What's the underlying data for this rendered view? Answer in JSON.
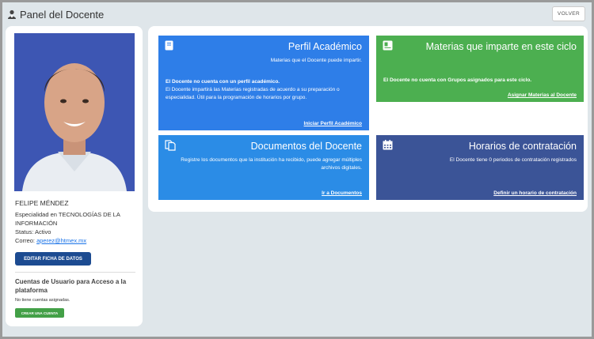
{
  "header": {
    "title": "Panel del Docente",
    "back_label": "VOLVER"
  },
  "teacher": {
    "name": "FELIPE MÉNDEZ",
    "specialty": "Especialidad en TECNOLOGÍAS DE LA INFORMACIÓN",
    "status": "Status: Activo",
    "email_label": "Correo: ",
    "email": "aperez@htmex.mx",
    "edit_label": "EDITAR FICHA DE DATOS"
  },
  "accounts": {
    "title": "Cuentas de Usuario para Acceso a la plataforma",
    "empty": "No tiene cuentas asignadas.",
    "create_label": "CREAR UNA CUENTA"
  },
  "cards": {
    "perfil": {
      "title": "Perfil Académico",
      "subtitle": "Materias que el Docente puede impartir.",
      "bold": "El Docente no cuenta con un perfil académico.",
      "text": "El Docente impartirá las Materias registradas de acuerdo a su preparación o especialidad. Útil para la programación de horarios por grupo.",
      "link": "Iniciar Perfil Académico"
    },
    "materias": {
      "title": "Materias que imparte en este ciclo",
      "bold": "El Docente no cuenta con Grupos asignados para este ciclo.",
      "link": "Asignar Materias al Docente"
    },
    "documentos": {
      "title": "Documentos del Docente",
      "subtitle": "Registre los documentos que la institución ha recibido, puede agregar múltiples archivos digitales.",
      "link": "Ir a Documentos"
    },
    "horarios": {
      "title": "Horarios de contratación",
      "subtitle": "El Docente tiene 0 periodos de contratación registrados",
      "link": "Definir un horario de contratación"
    }
  },
  "colors": {
    "perfil": "#2e7ee8",
    "materias": "#4caf50",
    "documentos": "#2b8ce6",
    "horarios": "#3b5497",
    "edit_button": "#1c4b91",
    "create_button": "#43a047"
  },
  "icons": {
    "header": "user-icon",
    "perfil": "notebook-icon",
    "materias": "book-icon",
    "documentos": "documents-icon",
    "horarios": "calendar-icon"
  }
}
